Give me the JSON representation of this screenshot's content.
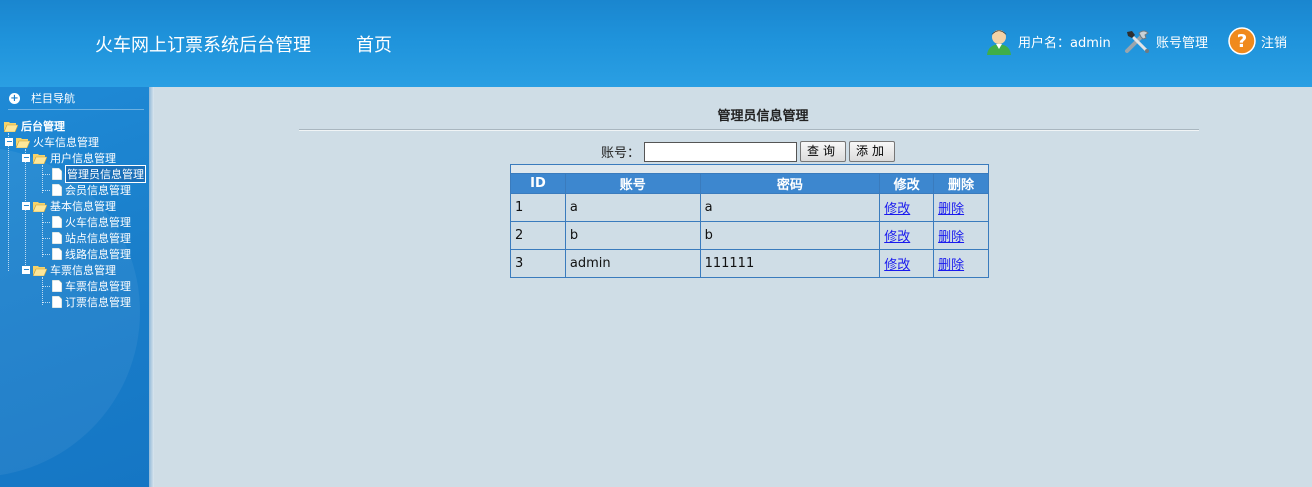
{
  "header": {
    "title": "火车网上订票系统后台管理",
    "home": "首页",
    "user_label": "用户名：admin",
    "account_label": "账号管理",
    "logout_label": "注销"
  },
  "sidebar": {
    "nav_title": "栏目导航",
    "root": "后台管理",
    "group": "火车信息管理",
    "sections": [
      {
        "label": "用户信息管理",
        "items": [
          "管理员信息管理",
          "会员信息管理"
        ]
      },
      {
        "label": "基本信息管理",
        "items": [
          "火车信息管理",
          "站点信息管理",
          "线路信息管理"
        ]
      },
      {
        "label": "车票信息管理",
        "items": [
          "车票信息管理",
          "订票信息管理"
        ]
      }
    ]
  },
  "main": {
    "title": "管理员信息管理",
    "search_label": "账号：",
    "search_value": "",
    "query_button": "查询",
    "add_button": "添加",
    "columns": [
      "ID",
      "账号",
      "密码",
      "修改",
      "删除"
    ],
    "rows": [
      {
        "id": "1",
        "account": "a",
        "password": "a",
        "edit": "修改",
        "delete": "删除"
      },
      {
        "id": "2",
        "account": "b",
        "password": "b",
        "edit": "修改",
        "delete": "删除"
      },
      {
        "id": "3",
        "account": "admin",
        "password": "111111",
        "edit": "修改",
        "delete": "删除"
      }
    ]
  },
  "colors": {
    "header_bg": "#1f93db",
    "sidebar_bg": "#1a7fcb",
    "content_bg": "#cfdde6",
    "table_header": "#3d87cf",
    "link": "#1a1aee"
  }
}
